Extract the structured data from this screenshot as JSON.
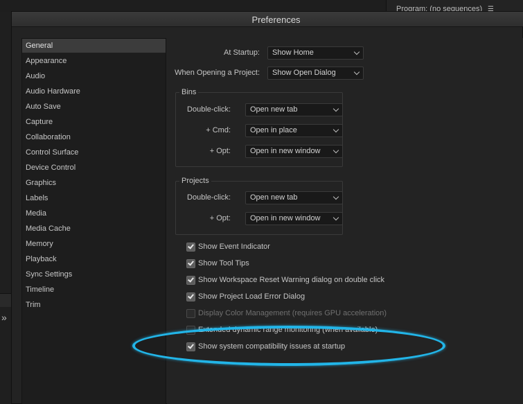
{
  "background": {
    "program_panel_title": "Program: (no sequences)",
    "panel_menu_icon": "hamburger-menu-icon",
    "collapse_icon": "double-chevron-right-icon"
  },
  "dialog": {
    "title": "Preferences"
  },
  "sidebar": {
    "items": [
      {
        "label": "General",
        "active": true
      },
      {
        "label": "Appearance"
      },
      {
        "label": "Audio"
      },
      {
        "label": "Audio Hardware"
      },
      {
        "label": "Auto Save"
      },
      {
        "label": "Capture"
      },
      {
        "label": "Collaboration"
      },
      {
        "label": "Control Surface"
      },
      {
        "label": "Device Control"
      },
      {
        "label": "Graphics"
      },
      {
        "label": "Labels"
      },
      {
        "label": "Media"
      },
      {
        "label": "Media Cache"
      },
      {
        "label": "Memory"
      },
      {
        "label": "Playback"
      },
      {
        "label": "Sync Settings"
      },
      {
        "label": "Timeline"
      },
      {
        "label": "Trim"
      }
    ]
  },
  "general": {
    "startup": {
      "label": "At Startup:",
      "value": "Show Home"
    },
    "opening_project": {
      "label": "When Opening a Project:",
      "value": "Show Open Dialog"
    },
    "bins": {
      "title": "Bins",
      "rows": [
        {
          "label": "Double-click:",
          "value": "Open new tab"
        },
        {
          "label": "+ Cmd:",
          "value": "Open in place"
        },
        {
          "label": "+ Opt:",
          "value": "Open in new window"
        }
      ]
    },
    "projects": {
      "title": "Projects",
      "rows": [
        {
          "label": "Double-click:",
          "value": "Open new tab"
        },
        {
          "label": "+ Opt:",
          "value": "Open in new window"
        }
      ]
    },
    "checkboxes": [
      {
        "label": "Show Event Indicator",
        "checked": true,
        "enabled": true
      },
      {
        "label": "Show Tool Tips",
        "checked": true,
        "enabled": true
      },
      {
        "label": "Show Workspace Reset Warning dialog on double click",
        "checked": true,
        "enabled": true
      },
      {
        "label": "Show Project Load Error Dialog",
        "checked": true,
        "enabled": true
      },
      {
        "label": "Display Color Management (requires GPU acceleration)",
        "checked": false,
        "enabled": false
      },
      {
        "label": "Extended dynamic range monitoring (when available)",
        "checked": false,
        "enabled": true
      },
      {
        "label": "Show system compatibility issues at startup",
        "checked": true,
        "enabled": true
      }
    ]
  },
  "colors": {
    "highlight": "#22b5e8",
    "panel_bg": "#232323",
    "sidebar_bg": "#1d1d1d",
    "active_item_bg": "#3c3c3c"
  }
}
